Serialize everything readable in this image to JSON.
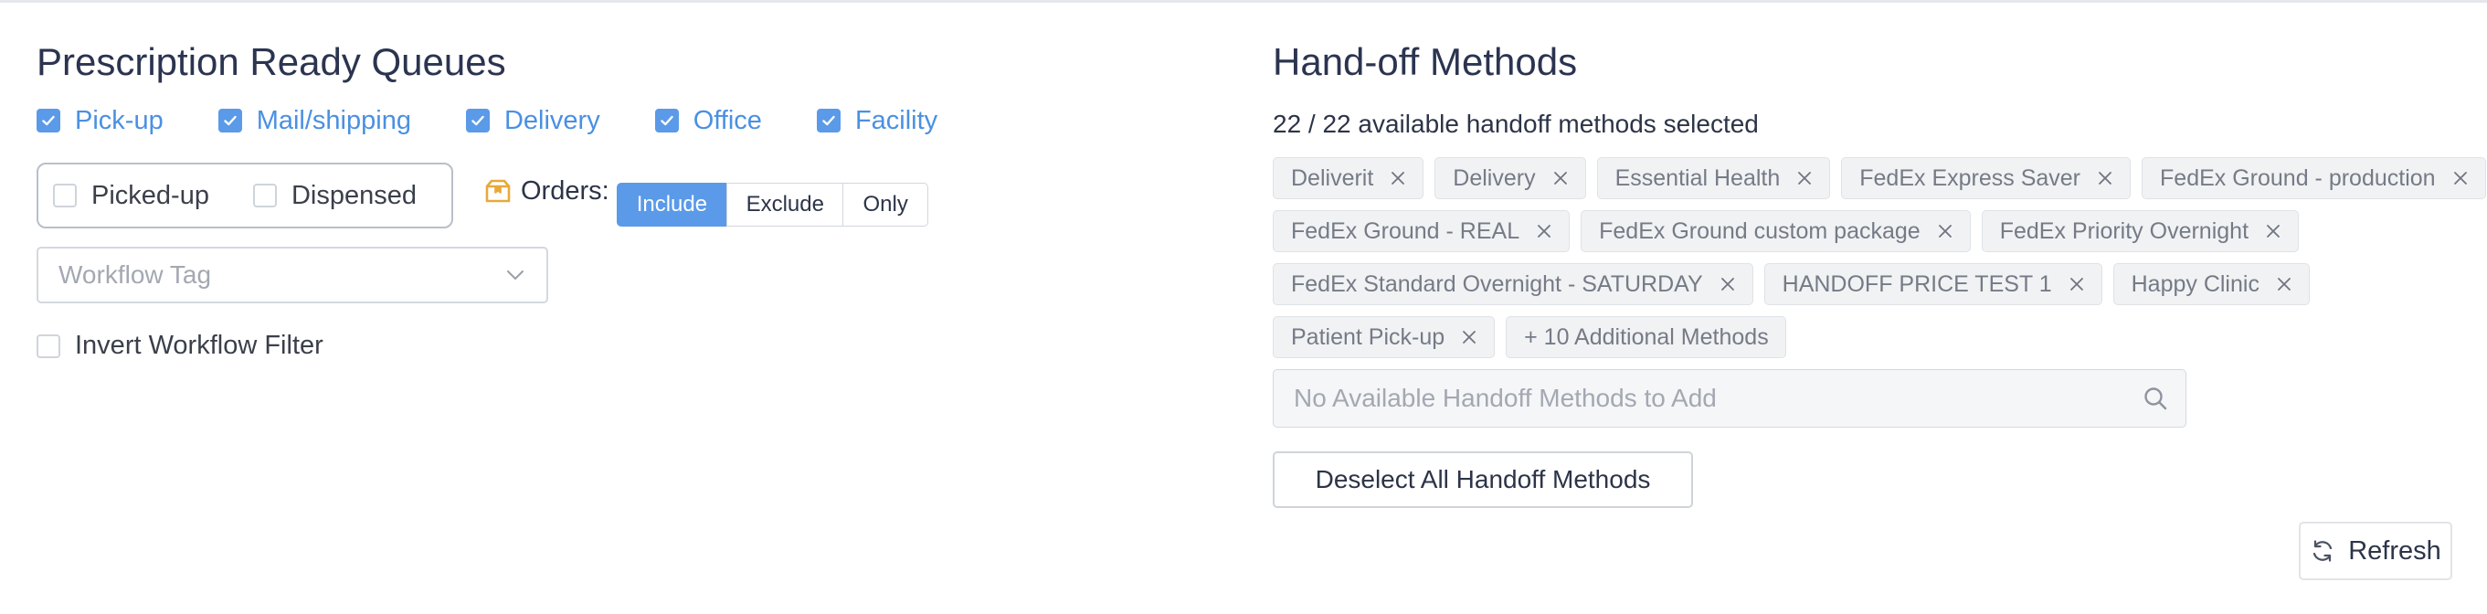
{
  "queues_panel": {
    "title": "Prescription Ready Queues",
    "queues": [
      {
        "label": "Pick-up",
        "checked": true
      },
      {
        "label": "Mail/shipping",
        "checked": true
      },
      {
        "label": "Delivery",
        "checked": true
      },
      {
        "label": "Office",
        "checked": true
      },
      {
        "label": "Facility",
        "checked": true
      }
    ],
    "status_filters": [
      {
        "label": "Picked-up",
        "checked": false
      },
      {
        "label": "Dispensed",
        "checked": false
      }
    ],
    "orders": {
      "label": "Orders:",
      "icon": "box-icon",
      "options": [
        "Include",
        "Exclude",
        "Only"
      ],
      "selected": "Include"
    },
    "workflow_tag": {
      "placeholder": "Workflow Tag"
    },
    "invert_filter": {
      "label": "Invert Workflow Filter",
      "checked": false
    }
  },
  "handoff_panel": {
    "title": "Hand-off Methods",
    "selected_count": "22 / 22 available handoff methods selected",
    "tags": [
      "Deliverit",
      "Delivery",
      "Essential Health",
      "FedEx Express Saver",
      "FedEx Ground - production",
      "FedEx Ground - REAL",
      "FedEx Ground custom package",
      "FedEx Priority Overnight",
      "FedEx Standard Overnight - SATURDAY",
      "HANDOFF PRICE TEST 1",
      "Happy Clinic",
      "Patient Pick-up"
    ],
    "more_label": "+ 10 Additional Methods",
    "search_placeholder": "No Available Handoff Methods to Add",
    "deselect_label": "Deselect All Handoff Methods"
  },
  "refresh_label": "Refresh",
  "colors": {
    "accent": "#5a9ae8",
    "link": "#4a90e2",
    "title": "#2b3450",
    "orders_icon": "#e8a93a"
  }
}
